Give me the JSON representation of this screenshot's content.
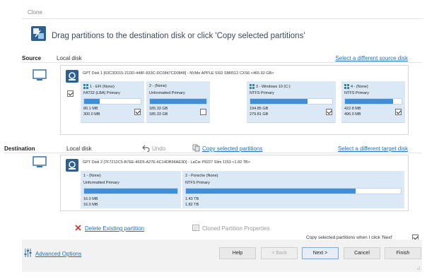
{
  "window": {
    "title": "Clone"
  },
  "header": {
    "text": "Drag partitions to the destination disk or click 'Copy selected partitions'"
  },
  "source": {
    "label": "Source",
    "value": "Local disk",
    "change_link": "Select a different source disk",
    "disk_info": "GPT Disk 1 [63C3D015-21DD-448F-833C-DC0847CD0848] - NVMe    APPLE SSD SM0512 CXS6  <465.92 GB>",
    "select_all_checked": true,
    "partitions": [
      {
        "name": "1 - EFI (None)",
        "type": "FAT32 (LBA) Primary",
        "used": "80.1 MB",
        "total": "300.0 MB",
        "fill_percent": 28,
        "checked": true,
        "win_logo": true
      },
      {
        "name": "2 - (None)",
        "type": "Unformatted Primary",
        "used": "185.33 GB",
        "total": "185.33 GB",
        "fill_percent": 100,
        "checked": false,
        "win_logo": false
      },
      {
        "name": "3 - Windows 10 (C:)",
        "type": "NTFS Primary",
        "used": "194.85 GB",
        "total": "279.81 GB",
        "fill_percent": 70,
        "checked": true,
        "win_logo": true
      },
      {
        "name": "4 - (None)",
        "type": "NTFS Primary",
        "used": "422.8 MB",
        "total": "496.0 MB",
        "fill_percent": 85,
        "checked": true,
        "win_logo": true
      }
    ]
  },
  "destination": {
    "label": "Destination",
    "value": "Local disk",
    "undo_label": "Undo",
    "copy_link": "Copy selected partitions",
    "change_link": "Select a different target disk",
    "disk_info": "GPT Disk 2 [7F7212C5-B7EE-46D5-A27E-6C14DB96AE3D] - LaCie   P9227 Slim     1153  <1.82 TB>",
    "partitions": [
      {
        "name": "1 - (None)",
        "type": "Unformatted Primary",
        "used": "16.0 MB",
        "total": "16.0 MB",
        "fill_percent": 100
      },
      {
        "name": "2 - Porsche (None)",
        "type": "NTFS Primary",
        "used": "1.43 TB",
        "total": "1.82 TB",
        "fill_percent": 79
      }
    ],
    "delete_link": "Delete Existing partition",
    "cloned_props": "Cloned Partition Properties"
  },
  "copy_on_next": {
    "label": "Copy selected partitions when I click 'Next'",
    "checked": true
  },
  "footer": {
    "advanced_link": "Advanced Options",
    "help": "Help",
    "back": "< Back",
    "next": "Next >",
    "cancel": "Cancel",
    "finish": "Finish"
  },
  "colors": {
    "accent": "#3e8fd8",
    "partition_bg": "#dbe9f7",
    "link": "#1e6fc7",
    "delete_x": "#d9342b"
  }
}
